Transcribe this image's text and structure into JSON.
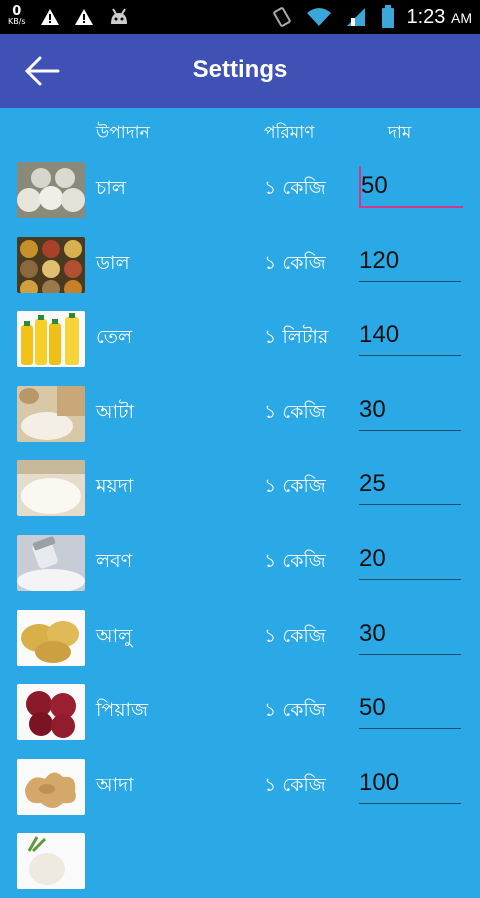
{
  "status_bar": {
    "net_speed": "0",
    "net_unit": "KB/s",
    "time": "1:23",
    "ampm": "AM"
  },
  "app_bar": {
    "title": "Settings"
  },
  "columns": {
    "item": "উপাদান",
    "quantity": "পরিমাণ",
    "price": "দাম"
  },
  "items": [
    {
      "name": "চাল",
      "quantity": "১ কেজি",
      "price": "50"
    },
    {
      "name": "ডাল",
      "quantity": "১ কেজি",
      "price": "120"
    },
    {
      "name": "তেল",
      "quantity": "১ লিটার",
      "price": "140"
    },
    {
      "name": "আটা",
      "quantity": "১ কেজি",
      "price": "30"
    },
    {
      "name": "ময়দা",
      "quantity": "১ কেজি",
      "price": "25"
    },
    {
      "name": "লবণ",
      "quantity": "১ কেজি",
      "price": "20"
    },
    {
      "name": "আলু",
      "quantity": "১ কেজি",
      "price": "30"
    },
    {
      "name": "পিয়াজ",
      "quantity": "১ কেজি",
      "price": "50"
    },
    {
      "name": "আদা",
      "quantity": "১ কেজি",
      "price": "100"
    }
  ],
  "colors": {
    "background": "#2aa9e6",
    "app_bar": "#3f51b5",
    "status_bar": "#000000",
    "focus_accent": "#d03a84"
  }
}
